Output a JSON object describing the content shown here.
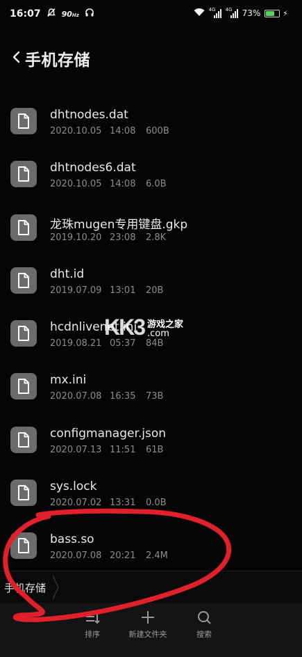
{
  "status_bar": {
    "time": "16:07",
    "net_speed": "90",
    "net_speed_unit": "Hz",
    "signal_label_1": "4G",
    "signal_label_2": "4G",
    "battery_percent": "73%",
    "battery_level": 0.73
  },
  "header": {
    "title": "手机存储"
  },
  "files": [
    {
      "name": "dhtnodes.dat",
      "date": "2020.10.05",
      "time": "14:08",
      "size": "600B"
    },
    {
      "name": "dhtnodes6.dat",
      "date": "2020.10.05",
      "time": "14:08",
      "size": "6.0B"
    },
    {
      "name": "龙珠mugen专用键盘.gkp",
      "date": "2019.10.20",
      "time": "23:08",
      "size": "2.8K"
    },
    {
      "name": "dht.id",
      "date": "2019.07.09",
      "time": "13:01",
      "size": "20B"
    },
    {
      "name": "hcdnlivenet.ini",
      "date": "2019.08.21",
      "time": "05:37",
      "size": "84B"
    },
    {
      "name": "mx.ini",
      "date": "2020.07.08",
      "time": "16:35",
      "size": "73B"
    },
    {
      "name": "configmanager.json",
      "date": "2020.07.13",
      "time": "11:51",
      "size": "61B"
    },
    {
      "name": "sys.lock",
      "date": "2020.07.02",
      "time": "13:31",
      "size": "0.0B"
    },
    {
      "name": "bass.so",
      "date": "2020.07.08",
      "time": "20:21",
      "size": "2.4M"
    }
  ],
  "path_bar": {
    "crumb": "手机存储"
  },
  "bottom_bar": {
    "sort_label": "排序",
    "new_folder_label": "新建文件夹",
    "search_label": "搜索"
  },
  "watermark": {
    "logo": "KK3",
    "site_line1": "游戏之家",
    "site_line2": ".com"
  },
  "colors": {
    "background": "#050505",
    "icon_box": "#6b6b6b",
    "annotation_red": "#e0202a",
    "battery": "#58d25a"
  }
}
